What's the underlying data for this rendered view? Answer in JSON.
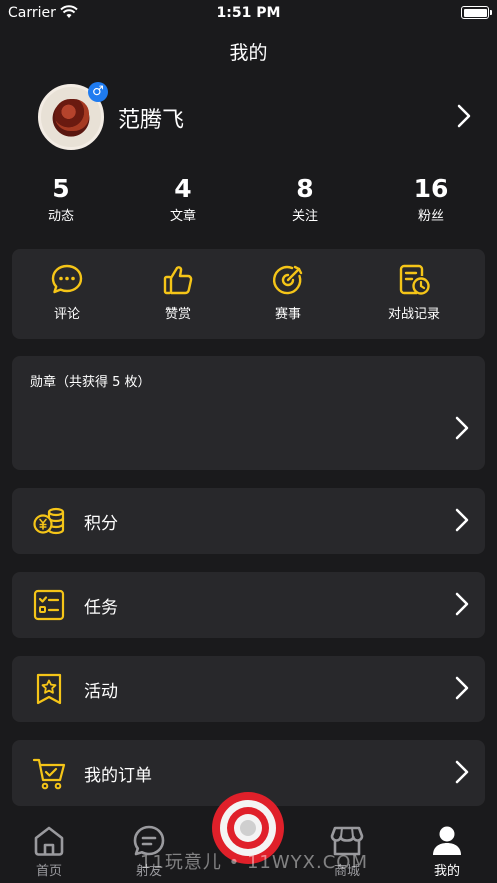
{
  "status_bar": {
    "carrier": "Carrier",
    "time": "1:51 PM"
  },
  "nav": {
    "title": "我的"
  },
  "profile": {
    "name": "范腾飞",
    "gender_symbol": "♂"
  },
  "stats": [
    {
      "value": "5",
      "label": "动态"
    },
    {
      "value": "4",
      "label": "文章"
    },
    {
      "value": "8",
      "label": "关注"
    },
    {
      "value": "16",
      "label": "粉丝"
    }
  ],
  "shortcuts": [
    {
      "label": "评论",
      "icon": "comment-icon"
    },
    {
      "label": "赞赏",
      "icon": "thumbs-up-icon"
    },
    {
      "label": "赛事",
      "icon": "target-dart-icon"
    },
    {
      "label": "对战记录",
      "icon": "battle-record-icon"
    }
  ],
  "medals": {
    "title": "勋章（共获得 5 枚）"
  },
  "menu": [
    {
      "label": "积分",
      "icon": "coins-icon"
    },
    {
      "label": "任务",
      "icon": "task-list-icon"
    },
    {
      "label": "活动",
      "icon": "star-bookmark-icon"
    },
    {
      "label": "我的订单",
      "icon": "shopping-cart-icon"
    }
  ],
  "tabbar": [
    {
      "label": "首页",
      "icon": "home-icon"
    },
    {
      "label": "射友",
      "icon": "chat-bubble-icon"
    },
    {
      "label": "商城",
      "icon": "store-icon"
    },
    {
      "label": "我的",
      "icon": "person-icon",
      "active": true
    }
  ],
  "watermark": "11玩意儿 • 11WYX.COM",
  "colors": {
    "accent": "#f5c518",
    "background": "#1a1a1c",
    "card": "#28282b",
    "badge": "#1e7bf0",
    "center_button": "#e0202a"
  }
}
